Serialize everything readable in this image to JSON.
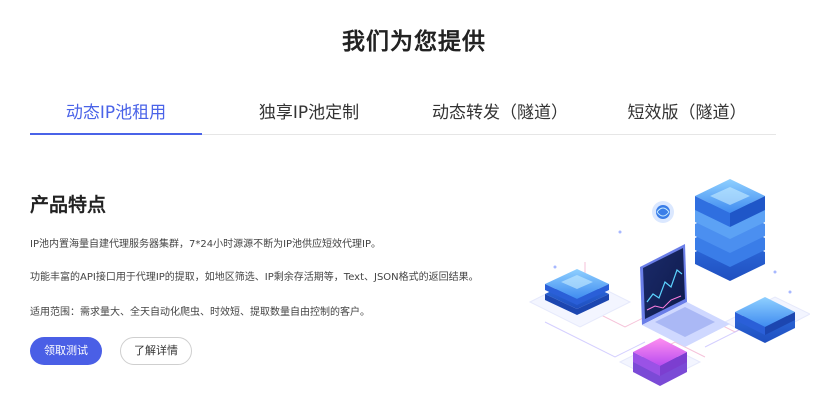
{
  "header": {
    "title": "我们为您提供"
  },
  "tabs": [
    {
      "label": "动态IP池租用",
      "active": true
    },
    {
      "label": "独享IP池定制",
      "active": false
    },
    {
      "label": "动态转发（隧道）",
      "active": false
    },
    {
      "label": "短效版（隧道）",
      "active": false
    }
  ],
  "main": {
    "section_title": "产品特点",
    "features": [
      "IP池内置海量自建代理服务器集群，7*24小时源源不断为IP池供应短效代理IP。",
      "功能丰富的API接口用于代理IP的提取，如地区筛选、IP剩余存活期等，Text、JSON格式的返回结果。",
      "适用范围：需求量大、全天自动化爬虫、时效短、提取数量自由控制的客户。"
    ],
    "primary_button": "领取测试",
    "secondary_button": "了解详情"
  },
  "illustration": {
    "name": "server-network-illustration"
  },
  "colors": {
    "accent": "#4a63e8",
    "button": "#4a5fe6"
  }
}
